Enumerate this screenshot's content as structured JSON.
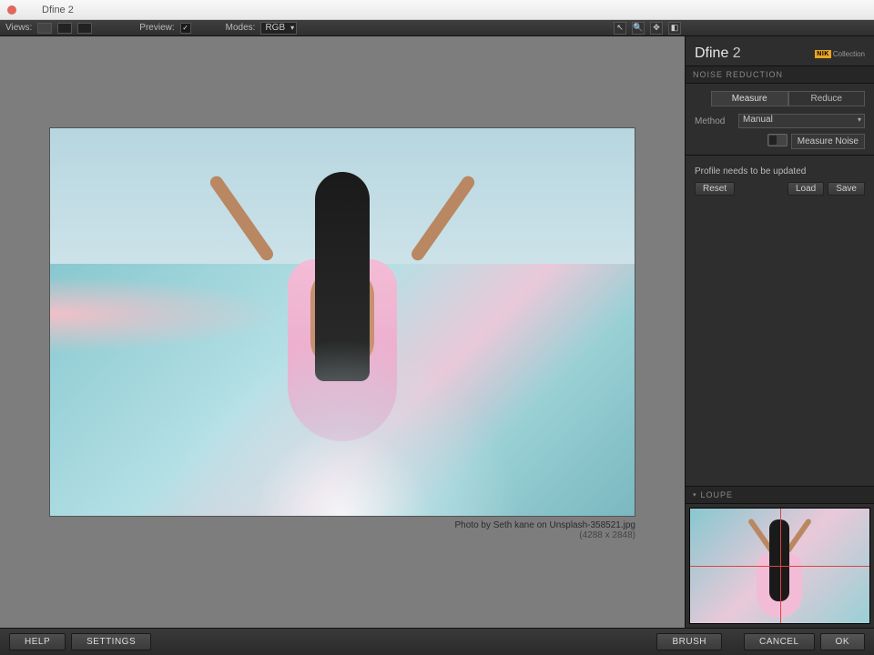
{
  "window": {
    "title": "Dfine 2"
  },
  "toolbar": {
    "views_label": "Views:",
    "preview_label": "Preview:",
    "modes_label": "Modes:",
    "mode_value": "RGB"
  },
  "image": {
    "caption": "Photo by Seth kane on Unsplash-358521.jpg",
    "dimensions": "(4288 x 2848)"
  },
  "side": {
    "app_title_a": "Dfine ",
    "app_title_b": "2",
    "brand_badge": "NIK",
    "brand_text": "Collection",
    "panel_noise": "NOISE REDUCTION",
    "tab_measure": "Measure",
    "tab_reduce": "Reduce",
    "method_label": "Method",
    "method_value": "Manual",
    "measure_noise": "Measure Noise",
    "profile_status": "Profile needs to be updated",
    "reset": "Reset",
    "load": "Load",
    "save": "Save",
    "loupe_title": "LOUPE"
  },
  "footer": {
    "help": "HELP",
    "settings": "SETTINGS",
    "brush": "BRUSH",
    "cancel": "CANCEL",
    "ok": "OK"
  }
}
